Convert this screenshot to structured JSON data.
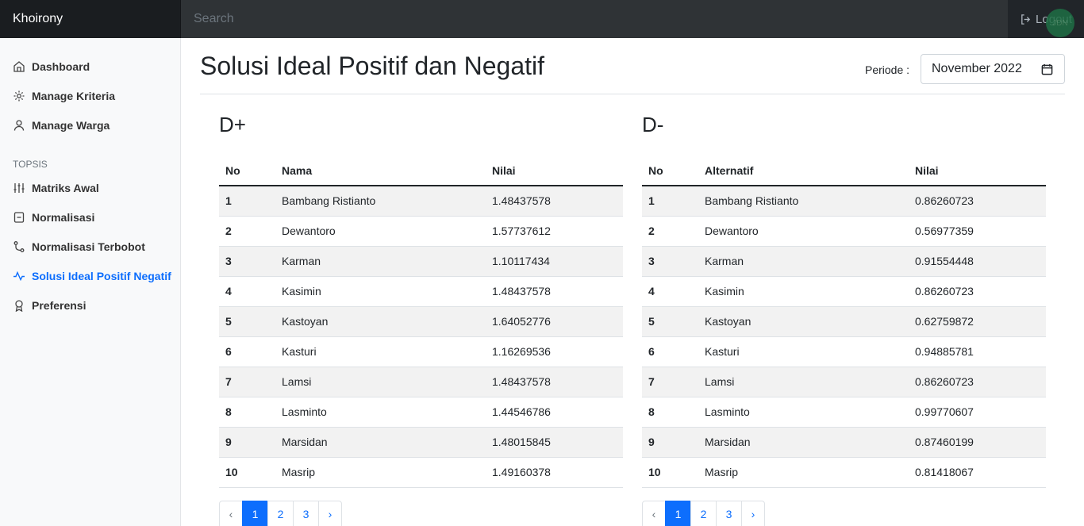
{
  "navbar": {
    "brand": "Khoirony",
    "search_placeholder": "Search",
    "logout_label": "Logout",
    "avatar_text": "JDN"
  },
  "sidebar": {
    "items": [
      {
        "label": "Dashboard",
        "icon": "home-icon"
      },
      {
        "label": "Manage Kriteria",
        "icon": "gear-icon"
      },
      {
        "label": "Manage Warga",
        "icon": "user-icon"
      }
    ],
    "section_heading": "TOPSIS",
    "topsis_items": [
      {
        "label": "Matriks Awal",
        "icon": "sliders-icon"
      },
      {
        "label": "Normalisasi",
        "icon": "file-icon"
      },
      {
        "label": "Normalisasi Terbobot",
        "icon": "git-icon"
      },
      {
        "label": "Solusi Ideal Positif Negatif",
        "icon": "activity-icon",
        "active": true
      },
      {
        "label": "Preferensi",
        "icon": "award-icon"
      }
    ]
  },
  "main": {
    "title": "Solusi Ideal Positif dan Negatif",
    "periode_label": "Periode :",
    "periode_value": "November 2022"
  },
  "d_plus": {
    "heading": "D+",
    "headers": [
      "No",
      "Nama",
      "Nilai"
    ],
    "rows": [
      [
        "1",
        "Bambang Ristianto",
        "1.48437578"
      ],
      [
        "2",
        "Dewantoro",
        "1.57737612"
      ],
      [
        "3",
        "Karman",
        "1.10117434"
      ],
      [
        "4",
        "Kasimin",
        "1.48437578"
      ],
      [
        "5",
        "Kastoyan",
        "1.64052776"
      ],
      [
        "6",
        "Kasturi",
        "1.16269536"
      ],
      [
        "7",
        "Lamsi",
        "1.48437578"
      ],
      [
        "8",
        "Lasminto",
        "1.44546786"
      ],
      [
        "9",
        "Marsidan",
        "1.48015845"
      ],
      [
        "10",
        "Masrip",
        "1.49160378"
      ]
    ],
    "pages": [
      "‹",
      "1",
      "2",
      "3",
      "›"
    ]
  },
  "d_minus": {
    "heading": "D-",
    "headers": [
      "No",
      "Alternatif",
      "Nilai"
    ],
    "rows": [
      [
        "1",
        "Bambang Ristianto",
        "0.86260723"
      ],
      [
        "2",
        "Dewantoro",
        "0.56977359"
      ],
      [
        "3",
        "Karman",
        "0.91554448"
      ],
      [
        "4",
        "Kasimin",
        "0.86260723"
      ],
      [
        "5",
        "Kastoyan",
        "0.62759872"
      ],
      [
        "6",
        "Kasturi",
        "0.94885781"
      ],
      [
        "7",
        "Lamsi",
        "0.86260723"
      ],
      [
        "8",
        "Lasminto",
        "0.99770607"
      ],
      [
        "9",
        "Marsidan",
        "0.87460199"
      ],
      [
        "10",
        "Masrip",
        "0.81418067"
      ]
    ],
    "pages": [
      "‹",
      "1",
      "2",
      "3",
      "›"
    ]
  },
  "colors": {
    "accent": "#0d6efd",
    "navbar": "#212529",
    "sidebar": "#f8f9fa"
  }
}
